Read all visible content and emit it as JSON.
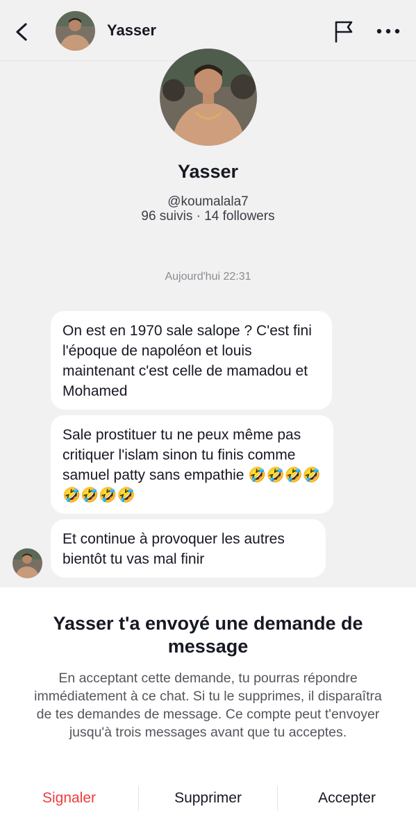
{
  "header": {
    "name": "Yasser"
  },
  "profile": {
    "name": "Yasser",
    "handle": "@koumalala7",
    "stats": "96 suivis · 14 followers"
  },
  "chat": {
    "timestamp": "Aujourd'hui 22:31",
    "messages": [
      {
        "text": "On est en 1970 sale salope ? C'est fini l'époque de napoléon et louis maintenant c'est celle de mamadou et Mohamed"
      },
      {
        "text": "Sale prostituer tu ne peux même pas critiquer l'islam sinon tu finis comme samuel patty sans empathie 🤣🤣🤣🤣🤣🤣🤣🤣"
      },
      {
        "text": "Et continue à provoquer les autres bientôt tu vas mal finir"
      }
    ]
  },
  "request": {
    "title": "Yasser t'a envoyé une demande de message",
    "body": "En acceptant cette demande, tu pourras répondre immédiatement à ce chat. Si tu le supprimes, il disparaîtra de tes demandes de message. Ce compte peut t'envoyer jusqu'à trois messages avant que tu acceptes.",
    "report_label": "Signaler",
    "delete_label": "Supprimer",
    "accept_label": "Accepter"
  },
  "icons": {
    "back": "chevron-left-icon",
    "flag": "flag-icon",
    "more": "more-horizontal-icon"
  },
  "colors": {
    "background": "#f1f1f2",
    "bubble": "#ffffff",
    "report": "#ee3b3b",
    "text": "#161823"
  }
}
